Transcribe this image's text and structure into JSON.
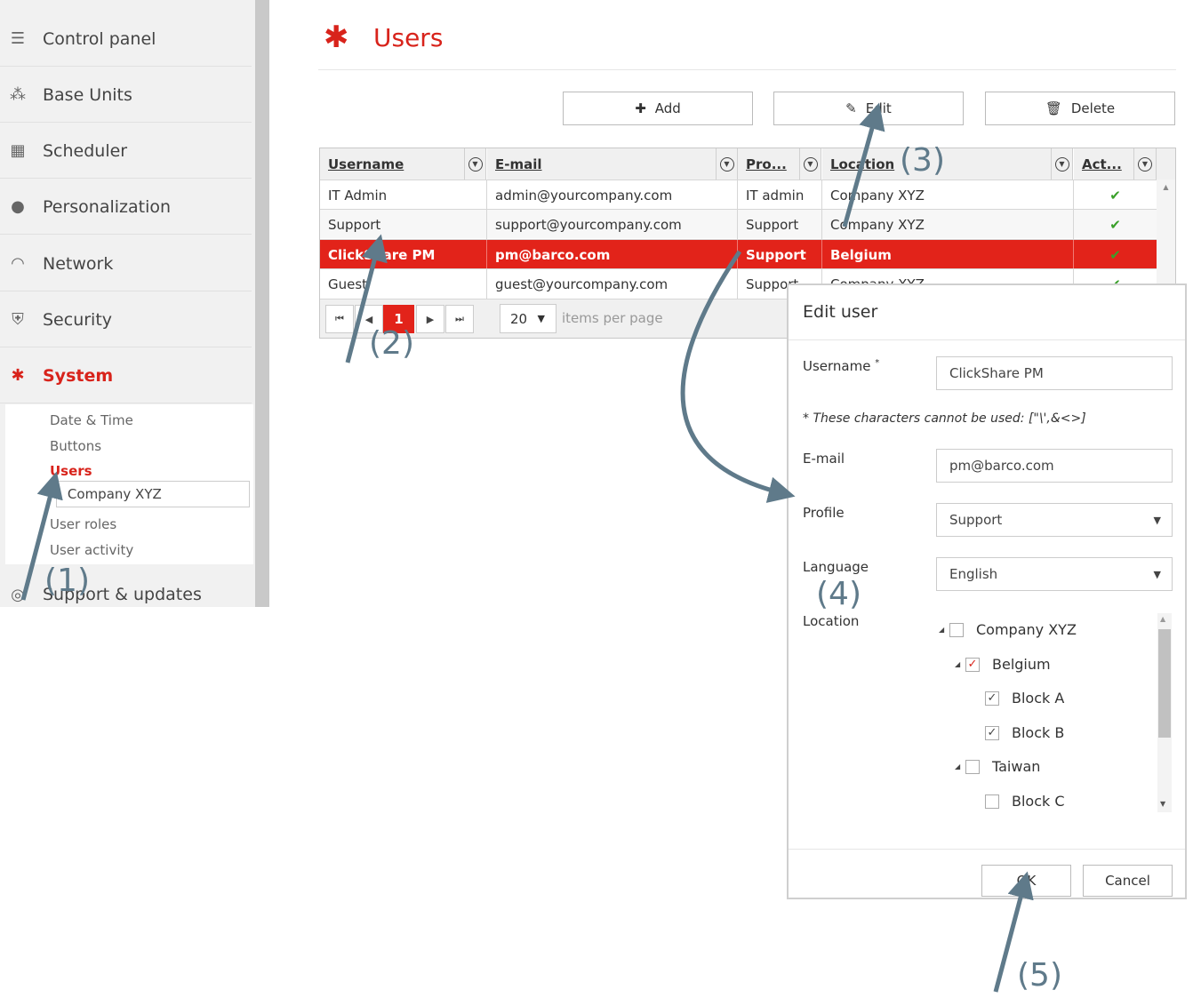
{
  "sidebar": {
    "items": [
      {
        "label": "Control panel",
        "icon": "server-icon"
      },
      {
        "label": "Base Units",
        "icon": "network-nodes-icon"
      },
      {
        "label": "Scheduler",
        "icon": "calendar-icon"
      },
      {
        "label": "Personalization",
        "icon": "person-icon"
      },
      {
        "label": "Network",
        "icon": "wifi-icon"
      },
      {
        "label": "Security",
        "icon": "shield-icon"
      },
      {
        "label": "System",
        "icon": "gear-icon",
        "active": true
      },
      {
        "label": "Support & updates",
        "icon": "lifebuoy-icon"
      }
    ],
    "subitems": [
      {
        "label": "Date & Time"
      },
      {
        "label": "Buttons"
      },
      {
        "label": "Users",
        "active": true
      },
      {
        "label": "Company XYZ"
      },
      {
        "label": "User roles"
      },
      {
        "label": "User activity"
      }
    ]
  },
  "page": {
    "title": "Users"
  },
  "toolbar": {
    "add_label": "Add",
    "edit_label": "Edit",
    "delete_label": "Delete"
  },
  "grid": {
    "columns": [
      "Username",
      "E-mail",
      "Pro...",
      "Location",
      "Act..."
    ],
    "rows": [
      {
        "username": "IT Admin",
        "email": "admin@yourcompany.com",
        "profile": "IT admin",
        "location": "Company XYZ",
        "active": "✔"
      },
      {
        "username": "Support",
        "email": "support@yourcompany.com",
        "profile": "Support",
        "location": "Company XYZ",
        "active": "✔"
      },
      {
        "username": "ClickShare PM",
        "email": "pm@barco.com",
        "profile": "Support",
        "location": "Belgium",
        "active": "✔",
        "selected": true
      },
      {
        "username": "Guest",
        "email": "guest@yourcompany.com",
        "profile": "Support",
        "location": "Company XYZ",
        "active": "✔"
      }
    ]
  },
  "pager": {
    "current_page": "1",
    "per_page": "20",
    "per_page_label": "items per page"
  },
  "dialog": {
    "title": "Edit user",
    "username_label": "Username",
    "required_mark": "*",
    "username_value": "ClickShare PM",
    "note": "* These characters cannot be used: [\"\\',&<>]",
    "email_label": "E-mail",
    "email_value": "pm@barco.com",
    "profile_label": "Profile",
    "profile_value": "Support",
    "language_label": "Language",
    "language_value": "English",
    "location_label": "Location",
    "tree": [
      {
        "label": "Company XYZ",
        "checked": false
      },
      {
        "label": "Belgium",
        "checked": true
      },
      {
        "label": "Block A",
        "checked": true
      },
      {
        "label": "Block B",
        "checked": true
      },
      {
        "label": "Taiwan",
        "checked": false
      },
      {
        "label": "Block C",
        "checked": false
      }
    ],
    "ok_label": "OK",
    "cancel_label": "Cancel"
  },
  "callouts": [
    "(1)",
    "(2)",
    "(3)",
    "(4)",
    "(5)"
  ],
  "colors": {
    "accent": "#d8231b",
    "selected_row": "#e2231a",
    "callout": "#5f7a8a",
    "check": "#3aa02a"
  }
}
